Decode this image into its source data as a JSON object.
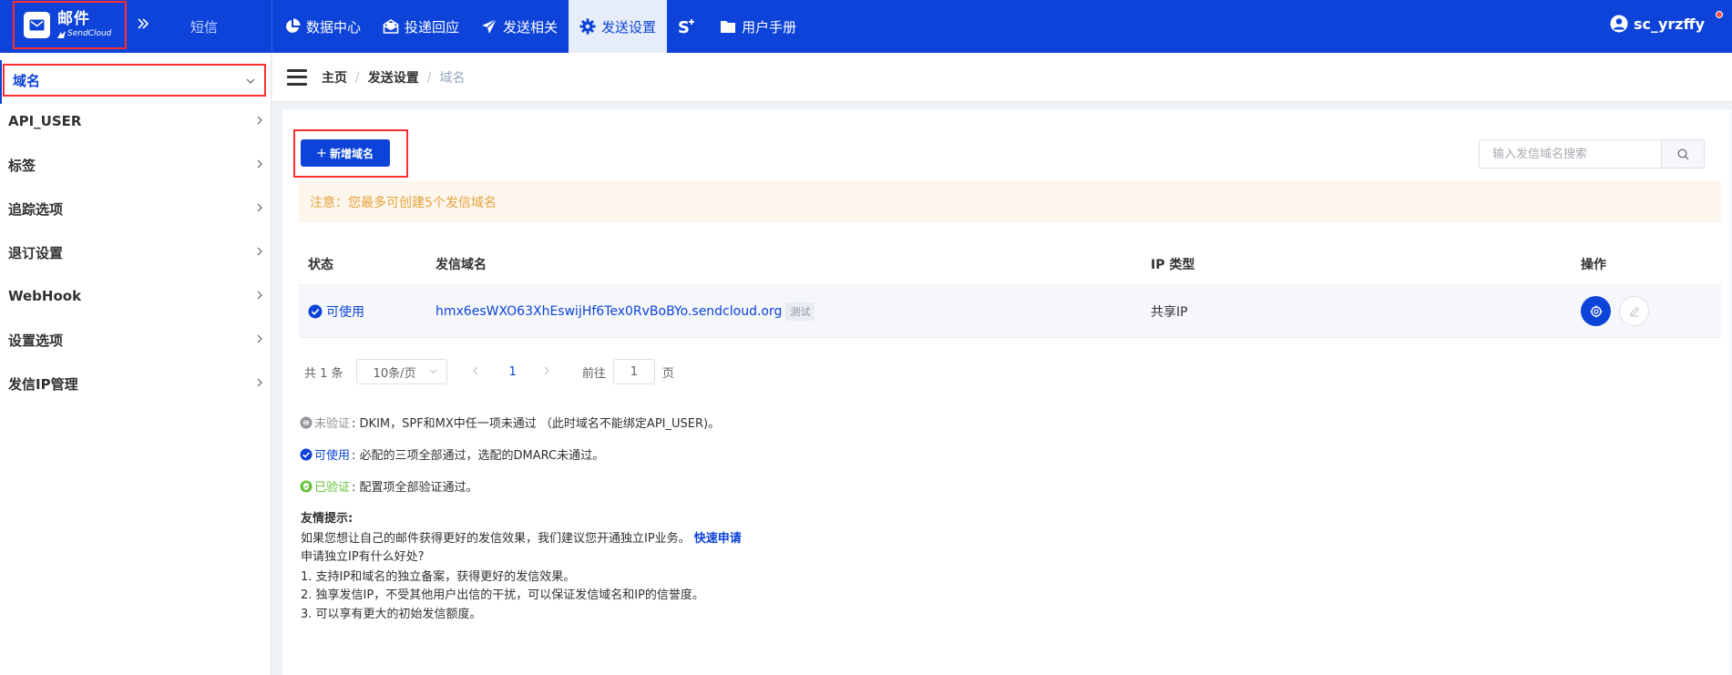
{
  "header": {
    "logo_title": "邮件",
    "logo_sub": "SendCloud",
    "sms_tab": "短信",
    "nav": [
      {
        "label": "数据中心",
        "icon": "pie-chart-icon"
      },
      {
        "label": "投递回应",
        "icon": "mail-open-icon"
      },
      {
        "label": "发送相关",
        "icon": "send-icon"
      },
      {
        "label": "发送设置",
        "icon": "gear-icon",
        "active": true
      },
      {
        "label": "S+",
        "icon": "s-plus-icon"
      },
      {
        "label": "用户手册",
        "icon": "folder-icon"
      }
    ],
    "username": "sc_yrzffy"
  },
  "sidebar": {
    "items": [
      {
        "label": "域名",
        "active": true
      },
      {
        "label": "API_USER"
      },
      {
        "label": "标签"
      },
      {
        "label": "追踪选项"
      },
      {
        "label": "退订设置"
      },
      {
        "label": "WebHook"
      },
      {
        "label": "设置选项"
      },
      {
        "label": "发信IP管理"
      }
    ]
  },
  "breadcrumb": [
    "主页",
    "发送设置",
    "域名"
  ],
  "toolbar": {
    "add_label": "新增域名",
    "search_placeholder": "输入发信域名搜索"
  },
  "notice": "注意：您最多可创建5个发信域名",
  "table": {
    "headers": [
      "状态",
      "发信域名",
      "IP 类型",
      "操作"
    ],
    "rows": [
      {
        "status": "可使用",
        "domain": "hmx6esWXO63XhEswijHf6Tex0RvBoBYo.sendcloud.org",
        "tag": "测试",
        "ip_type": "共享IP"
      }
    ]
  },
  "pagination": {
    "total": "共 1 条",
    "page_size": "10条/页",
    "current": "1",
    "goto_label": "前往",
    "goto_value": "1",
    "page_suffix": "页"
  },
  "legend": [
    {
      "name": "未验证",
      "desc": ": DKIM，SPF和MX中任一项未通过 （此时域名不能绑定API_USER)。"
    },
    {
      "name": "可使用",
      "desc": ": 必配的三项全部通过，选配的DMARC未通过。"
    },
    {
      "name": "已验证",
      "desc": ": 配置项全部验证通过。"
    }
  ],
  "tips": {
    "title": "友情提示:",
    "line1": "如果您想让自己的邮件获得更好的发信效果，我们建议您开通独立IP业务。",
    "link": "快速申请",
    "line2": "申请独立IP有什么好处?",
    "items": [
      "1. 支持IP和域名的独立备案，获得更好的发信效果。",
      "2. 独享发信IP，不受其他用户出信的干扰，可以保证发信域名和IP的信誉度。",
      "3. 可以享有更大的初始发信额度。"
    ]
  },
  "colors": {
    "primary": "#0d43d8",
    "highlight_border": "#ff2d2d",
    "notice_text": "#e6a23c",
    "verified": "#67c23a"
  }
}
